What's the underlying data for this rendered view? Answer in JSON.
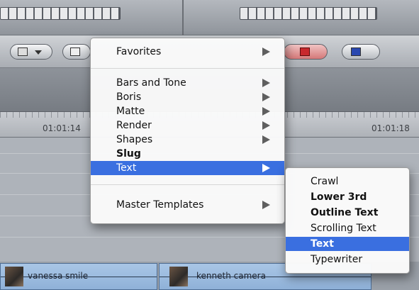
{
  "ruler": {
    "timecode_left": "01:01:14",
    "timecode_right": "01:01:18"
  },
  "clips": [
    {
      "name": "vanessa smile"
    },
    {
      "name": "kenneth camera"
    }
  ],
  "toolbar": {
    "buttons": [
      "video-generator-icon",
      "text-generator-icon",
      "mark-icon",
      "clip-overlay-icon"
    ]
  },
  "menu": {
    "items": [
      {
        "label": "Favorites",
        "submenu": true
      },
      {
        "label": "Bars and Tone",
        "submenu": true
      },
      {
        "label": "Boris",
        "submenu": true
      },
      {
        "label": "Matte",
        "submenu": true
      },
      {
        "label": "Render",
        "submenu": true
      },
      {
        "label": "Shapes",
        "submenu": true
      },
      {
        "label": "Slug",
        "bold": true
      },
      {
        "label": "Text",
        "submenu": true,
        "selected": true
      },
      {
        "label": "Master Templates",
        "submenu": true
      }
    ]
  },
  "submenu": {
    "items": [
      {
        "label": "Crawl"
      },
      {
        "label": "Lower 3rd",
        "bold": true
      },
      {
        "label": "Outline Text",
        "bold": true
      },
      {
        "label": "Scrolling Text"
      },
      {
        "label": "Text",
        "bold": true,
        "selected": true
      },
      {
        "label": "Typewriter"
      }
    ]
  },
  "colors": {
    "selection": "#3a6fe0",
    "clip": "#a9c6e6"
  }
}
